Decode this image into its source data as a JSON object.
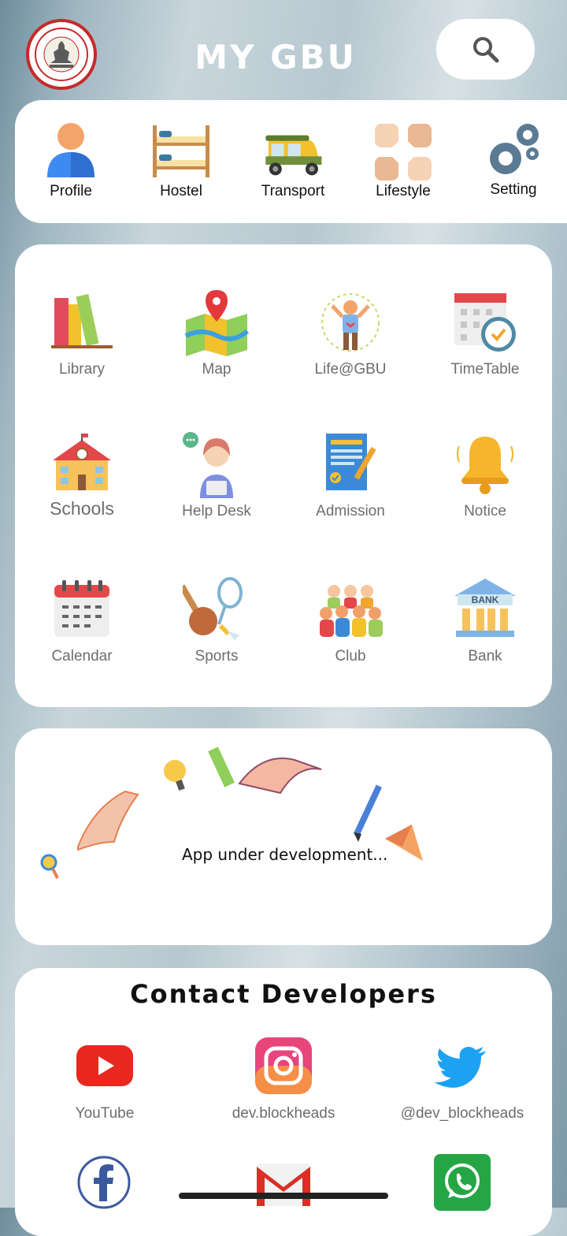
{
  "header": {
    "title": "MY GBU",
    "logo_icon": "university-seal-icon",
    "search_icon": "search-icon"
  },
  "quick_nav": [
    {
      "label": "Profile",
      "icon": "person-icon"
    },
    {
      "label": "Hostel",
      "icon": "bunk-bed-icon"
    },
    {
      "label": "Transport",
      "icon": "auto-rickshaw-icon"
    },
    {
      "label": "Lifestyle",
      "icon": "hands-icon"
    },
    {
      "label": "Setting",
      "icon": "gears-icon"
    }
  ],
  "features": [
    {
      "label": "Library",
      "icon": "books-icon"
    },
    {
      "label": "Map",
      "icon": "map-icon"
    },
    {
      "label": "Life@GBU",
      "icon": "student-icon"
    },
    {
      "label": "TimeTable",
      "icon": "calendar-clock-icon"
    },
    {
      "label": "Schools",
      "icon": "school-building-icon"
    },
    {
      "label": "Help Desk",
      "icon": "support-agent-icon"
    },
    {
      "label": "Admission",
      "icon": "form-pen-icon"
    },
    {
      "label": "Notice",
      "icon": "bell-icon"
    },
    {
      "label": "Calendar",
      "icon": "calendar-icon"
    },
    {
      "label": "Sports",
      "icon": "sports-icon"
    },
    {
      "label": "Club",
      "icon": "people-group-icon"
    },
    {
      "label": "Bank",
      "icon": "bank-icon"
    }
  ],
  "banner": {
    "text": "App under development..."
  },
  "contact": {
    "title": "Contact Developers",
    "items": [
      {
        "label": "YouTube",
        "icon": "youtube-icon"
      },
      {
        "label": "dev.blockheads",
        "icon": "instagram-icon"
      },
      {
        "label": "@dev_blockheads",
        "icon": "twitter-icon"
      },
      {
        "label": "",
        "icon": "facebook-icon"
      },
      {
        "label": "",
        "icon": "gmail-icon"
      },
      {
        "label": "",
        "icon": "whatsapp-icon"
      }
    ]
  },
  "colors": {
    "accent_red": "#c52a2a",
    "card_bg": "#ffffff",
    "label_gray": "#6d6d6d"
  }
}
